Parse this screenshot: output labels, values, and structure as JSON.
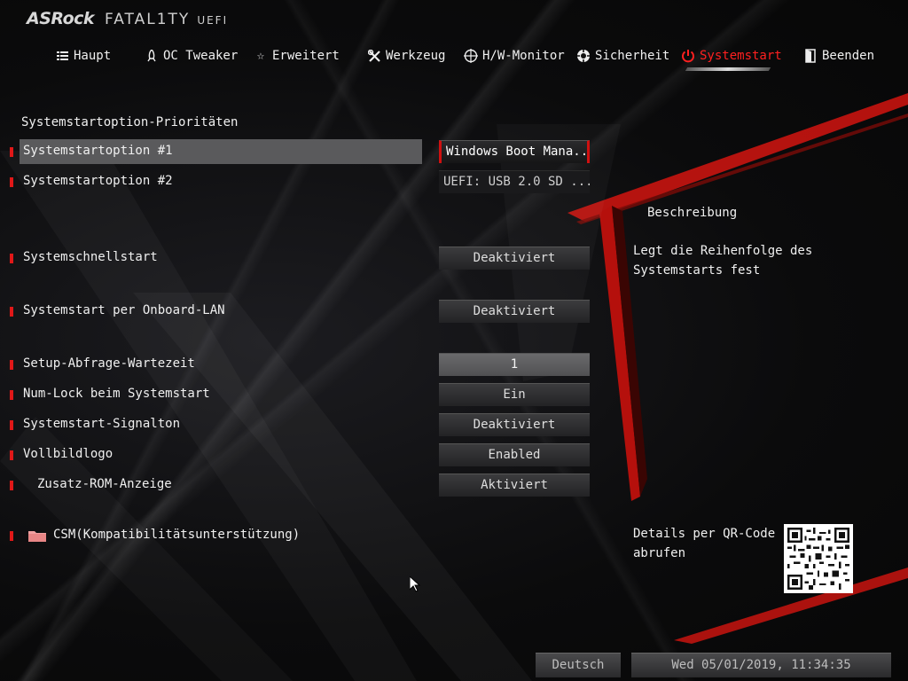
{
  "brand": {
    "name": "ASRock",
    "series": "FATAL1TY",
    "firmware": "UEFI"
  },
  "nav": {
    "tabs": [
      {
        "label": "Haupt",
        "icon": "list-icon"
      },
      {
        "label": "OC Tweaker",
        "icon": "rocket-icon"
      },
      {
        "label": "Erweitert",
        "icon": "star-icon"
      },
      {
        "label": "Werkzeug",
        "icon": "tools-icon"
      },
      {
        "label": "H/W-Monitor",
        "icon": "crosshair-icon"
      },
      {
        "label": "Sicherheit",
        "icon": "shield-icon"
      },
      {
        "label": "Systemstart",
        "icon": "power-icon"
      },
      {
        "label": "Beenden",
        "icon": "exit-door-icon"
      }
    ],
    "active": "Systemstart"
  },
  "settings": {
    "section_title": "Systemstartoption-Prioritäten",
    "items": [
      {
        "label": "Systemstartoption #1",
        "value": "Windows Boot Mana..."
      },
      {
        "label": "Systemstartoption #2",
        "value": "UEFI: USB 2.0 SD ..."
      },
      {
        "label": "Systemschnellstart",
        "value": "Deaktiviert"
      },
      {
        "label": "Systemstart per Onboard-LAN",
        "value": "Deaktiviert"
      },
      {
        "label": "Setup-Abfrage-Wartezeit",
        "value": "1"
      },
      {
        "label": "Num-Lock beim Systemstart",
        "value": "Ein"
      },
      {
        "label": "Systemstart-Signalton",
        "value": "Deaktiviert"
      },
      {
        "label": "Vollbildlogo",
        "value": "Enabled"
      },
      {
        "label": "Zusatz-ROM-Anzeige",
        "value": "Aktiviert"
      },
      {
        "label": "CSM(Kompatibilitätsunterstützung)",
        "icon": "folder-icon"
      }
    ]
  },
  "description": {
    "title": "Beschreibung",
    "text": "Legt die Reihenfolge des Systemstarts fest",
    "qr_text": "Details per QR-Code abrufen"
  },
  "footer": {
    "language": "Deutsch",
    "datetime": "Wed 05/01/2019, 11:34:35"
  },
  "colors": {
    "accent": "#e01818",
    "active_tab": "#ff2020",
    "selection": "#5a5a5c"
  }
}
